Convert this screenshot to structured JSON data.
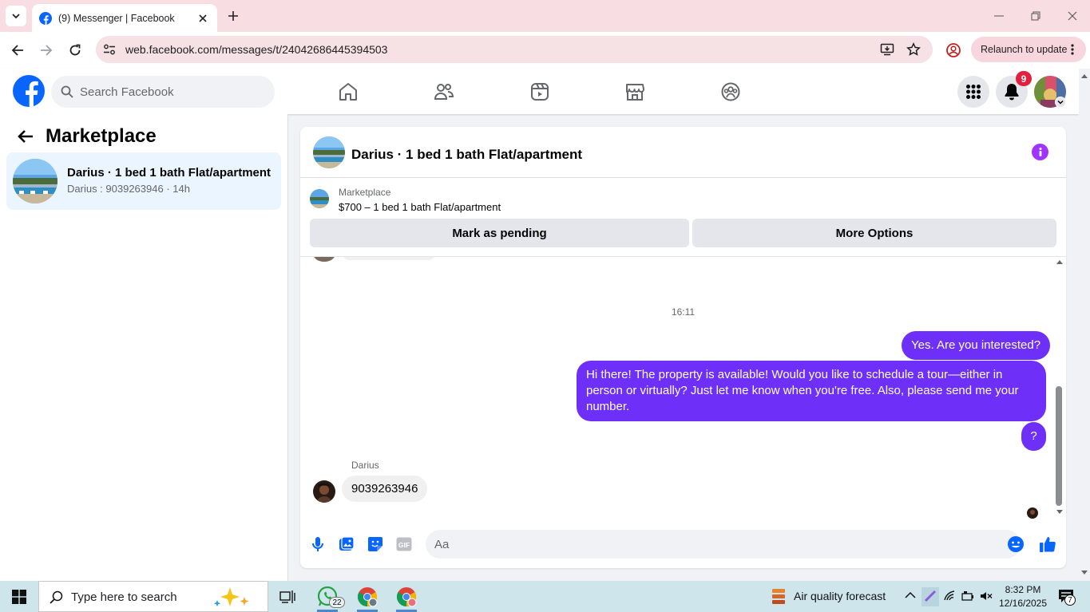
{
  "browser": {
    "tab_title": "(9) Messenger | Facebook",
    "url": "web.facebook.com/messages/t/24042686445394503",
    "relaunch_label": "Relaunch to update"
  },
  "fb_header": {
    "search_placeholder": "Search Facebook",
    "notification_count": "9"
  },
  "sidebar": {
    "title": "Marketplace",
    "conversation": {
      "title": "Darius · 1 bed 1 bath Flat/apartment",
      "preview": "Darius : 9039263946 · 14h"
    }
  },
  "chat": {
    "header_name": "Darius · 1 bed 1 bath Flat/apartment",
    "listing_label": "Marketplace",
    "listing_price": "$700 – 1 bed 1 bath Flat/apartment",
    "mark_pending_label": "Mark as pending",
    "more_options_label": "More Options",
    "timestamp": "16:11",
    "messages": [
      {
        "from": "me",
        "text": "Yes. Are you interested?"
      },
      {
        "from": "me",
        "text": "Hi there! The property is available! Would you like to schedule a tour—either in person or virtually? Just let me know when you're free. Also, please send me your number."
      },
      {
        "from": "me",
        "text": "?"
      },
      {
        "from": "Darius",
        "text": "9039263946"
      }
    ],
    "sender_label": "Darius",
    "composer_placeholder": "Aa"
  },
  "taskbar": {
    "search_text": "Type here to search",
    "whatsapp_badge": "22",
    "weather_text": "Air quality forecast",
    "time": "8:32 PM",
    "date": "12/16/2025",
    "notification_count": "7"
  },
  "colors": {
    "fb_blue": "#0866ff",
    "messenger_purple": "#6e2ff8",
    "badge_red": "#e41e3f",
    "selected_bg": "#ebf5ff"
  }
}
